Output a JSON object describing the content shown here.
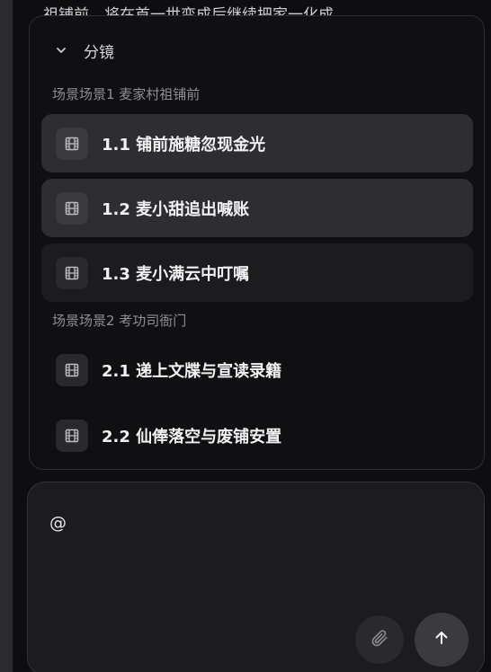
{
  "background": {
    "truncated_text": "祖铺前，将在首一世变成后继续把家一化成"
  },
  "panel": {
    "title": "分镜",
    "scenes": [
      {
        "label": "场景场景1 麦家村祖铺前",
        "shots": [
          {
            "label": "1.1 铺前施糖忽现金光",
            "state": "active"
          },
          {
            "label": "1.2 麦小甜追出喊账",
            "state": "active"
          },
          {
            "label": "1.3 麦小满云中叮嘱",
            "state": "alt"
          }
        ]
      },
      {
        "label": "场景场景2 考功司衙门",
        "shots": [
          {
            "label": "2.1 递上文牒与宣读录籍",
            "state": "plain"
          },
          {
            "label": "2.2 仙俸落空与废铺安置",
            "state": "plain"
          }
        ]
      }
    ]
  },
  "composer": {
    "value": "@",
    "attach_icon": "paperclip-icon",
    "send_icon": "arrow-up-icon"
  },
  "colors": {
    "page_bg": "#0e0e10",
    "panel_bg": "#101012",
    "active_item": "#2e2e31",
    "alt_item": "#1c1c1f",
    "secondary_text": "#8e8e93"
  }
}
